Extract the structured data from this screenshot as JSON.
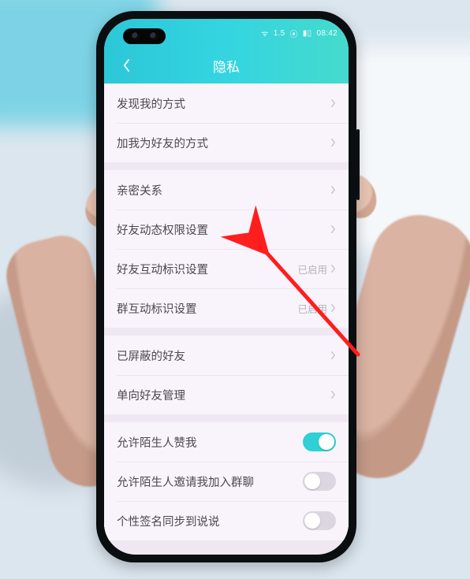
{
  "statusbar": {
    "signal": "ᯤ",
    "net": "1.5",
    "extra": "⦿",
    "battery": "▮▯",
    "time": "08:42"
  },
  "navbar": {
    "title": "隐私"
  },
  "groups": [
    [
      {
        "label": "发现我的方式"
      },
      {
        "label": "加我为好友的方式"
      }
    ],
    [
      {
        "label": "亲密关系"
      },
      {
        "label": "好友动态权限设置"
      },
      {
        "label": "好友互动标识设置",
        "value": "已启用"
      },
      {
        "label": "群互动标识设置",
        "value": "已启用"
      }
    ],
    [
      {
        "label": "已屏蔽的好友"
      },
      {
        "label": "单向好友管理"
      }
    ],
    [
      {
        "label": "允许陌生人赞我",
        "toggle": true,
        "on": true
      },
      {
        "label": "允许陌生人邀请我加入群聊",
        "toggle": true,
        "on": false
      },
      {
        "label": "个性签名同步到说说",
        "toggle": true,
        "on": false
      }
    ]
  ],
  "colors": {
    "accent_gradient_start": "#2cc7d8",
    "accent_gradient_end": "#45dacd",
    "toggle_on": "#2fd0d6",
    "annotation_arrow": "#ff1e1e"
  }
}
